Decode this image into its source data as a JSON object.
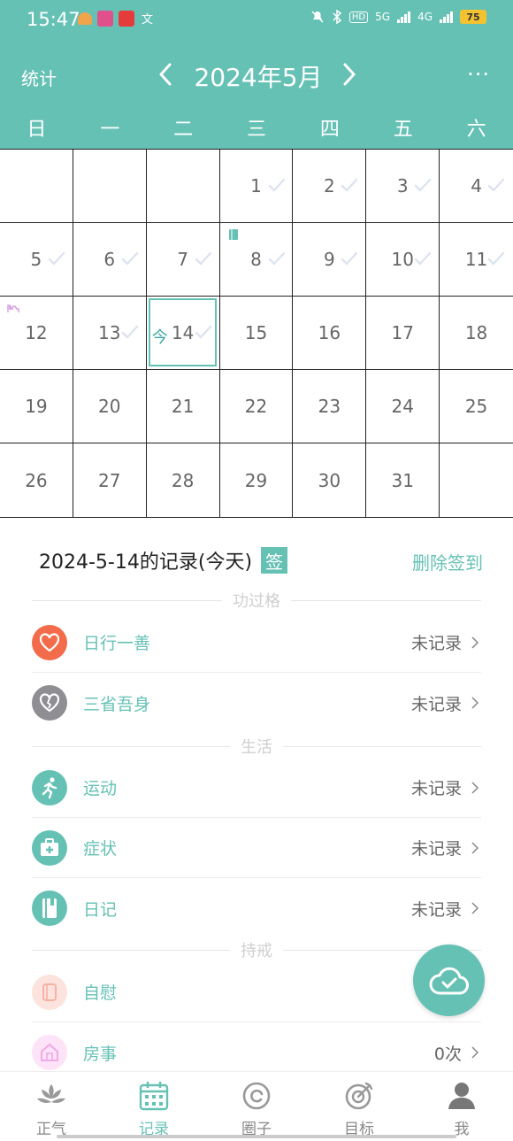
{
  "status_bar": {
    "time": "15:47",
    "hd_label": "HD",
    "net_5g": "5G",
    "net_4g": "4G",
    "battery": "75"
  },
  "header": {
    "stats_label": "统计",
    "month_title": "2024年5月",
    "more_label": "···",
    "weekdays": [
      "日",
      "一",
      "二",
      "三",
      "四",
      "五",
      "六"
    ]
  },
  "calendar": {
    "today_label": "今",
    "today_date": "14",
    "days": [
      {
        "d": ""
      },
      {
        "d": ""
      },
      {
        "d": ""
      },
      {
        "d": "1",
        "checked": true
      },
      {
        "d": "2",
        "checked": true
      },
      {
        "d": "3",
        "checked": true
      },
      {
        "d": "4",
        "checked": true
      },
      {
        "d": "5",
        "checked": true
      },
      {
        "d": "6",
        "checked": true
      },
      {
        "d": "7",
        "checked": true
      },
      {
        "d": "8",
        "checked": true,
        "mark": "diary"
      },
      {
        "d": "9",
        "checked": true
      },
      {
        "d": "10",
        "checked": true
      },
      {
        "d": "11",
        "checked": true
      },
      {
        "d": "12",
        "mark": "intimacy"
      },
      {
        "d": "13",
        "checked": true
      },
      {
        "d": "14",
        "checked": true,
        "today": true
      },
      {
        "d": "15"
      },
      {
        "d": "16"
      },
      {
        "d": "17"
      },
      {
        "d": "18"
      },
      {
        "d": "19"
      },
      {
        "d": "20"
      },
      {
        "d": "21"
      },
      {
        "d": "22"
      },
      {
        "d": "23"
      },
      {
        "d": "24"
      },
      {
        "d": "25"
      },
      {
        "d": "26"
      },
      {
        "d": "27"
      },
      {
        "d": "28"
      },
      {
        "d": "29"
      },
      {
        "d": "30"
      },
      {
        "d": "31"
      },
      {
        "d": ""
      }
    ]
  },
  "records": {
    "heading": "2024-5-14的记录(今天)",
    "sign_badge": "签",
    "delete_sign": "删除签到",
    "sections": {
      "merits": "功过格",
      "life": "生活",
      "abstain": "持戒"
    },
    "items": {
      "good_deed": {
        "label": "日行一善",
        "value": "未记录"
      },
      "reflect": {
        "label": "三省吾身",
        "value": "未记录"
      },
      "exercise": {
        "label": "运动",
        "value": "未记录"
      },
      "symptom": {
        "label": "症状",
        "value": "未记录"
      },
      "diary": {
        "label": "日记",
        "value": "未记录"
      },
      "self_pleasure": {
        "label": "自慰",
        "value": ""
      },
      "intimacy": {
        "label": "房事",
        "value": "0次"
      }
    }
  },
  "tabbar": {
    "tabs": [
      {
        "label": "正气"
      },
      {
        "label": "记录"
      },
      {
        "label": "圈子"
      },
      {
        "label": "目标"
      },
      {
        "label": "我"
      }
    ]
  },
  "colors": {
    "accent": "#66c1b5",
    "heart_red": "#f26b4a",
    "heart_gray": "#8e8e93"
  }
}
